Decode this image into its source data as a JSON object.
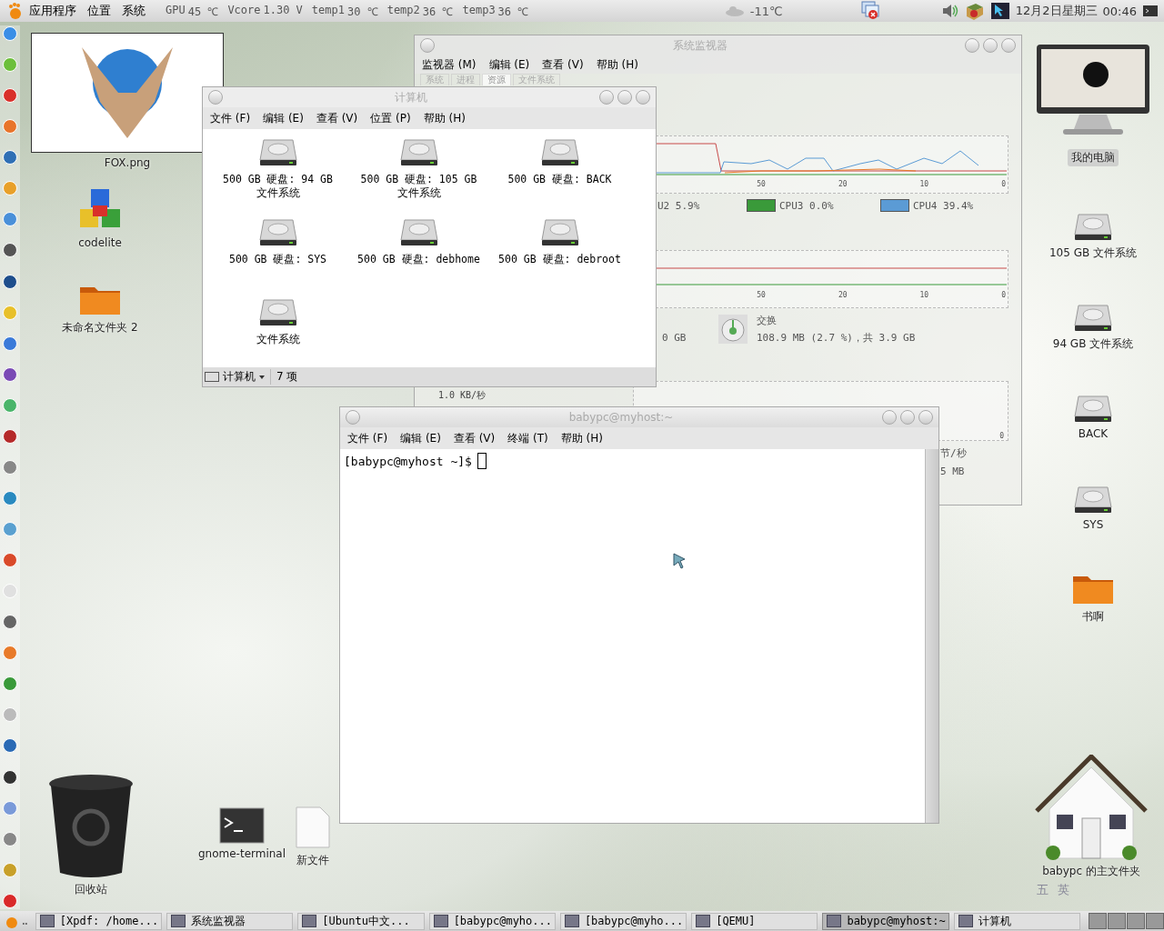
{
  "top_panel": {
    "menus": [
      "应用程序",
      "位置",
      "系统"
    ],
    "sensors": [
      {
        "label": "GPU",
        "value": "45 ℃"
      },
      {
        "label": "Vcore",
        "value": "1.30 V"
      },
      {
        "label": "temp1",
        "value": "30 ℃"
      },
      {
        "label": "temp2",
        "value": "36 ℃"
      },
      {
        "label": "temp3",
        "value": "36 ℃"
      }
    ],
    "weather": "-11℃",
    "date": "12月2日星期三",
    "time": "00:46"
  },
  "desktop_icons": [
    {
      "label": "FOX.png",
      "kind": "image"
    },
    {
      "label": "codelite",
      "kind": "app"
    },
    {
      "label": "未命名文件夹 2",
      "kind": "folder"
    },
    {
      "label": "回收站",
      "kind": "trash"
    },
    {
      "label": "gnome-terminal",
      "kind": "terminal"
    },
    {
      "label": "新文件",
      "kind": "file"
    },
    {
      "label": "我的电脑",
      "kind": "computer"
    },
    {
      "label": "105 GB 文件系统",
      "kind": "drive"
    },
    {
      "label": "94 GB 文件系统",
      "kind": "drive"
    },
    {
      "label": "BACK",
      "kind": "drive"
    },
    {
      "label": "SYS",
      "kind": "drive"
    },
    {
      "label": "书啊",
      "kind": "folder"
    },
    {
      "label": "babypc 的主文件夹",
      "kind": "house"
    }
  ],
  "system_monitor": {
    "title": "系统监视器",
    "menus": [
      "监视器 (M)",
      "编辑 (E)",
      "查看 (V)",
      "帮助 (H)"
    ],
    "tabs": [
      {
        "label": "系统",
        "selected": false
      },
      {
        "label": "进程",
        "selected": false
      },
      {
        "label": "资源",
        "selected": true
      },
      {
        "label": "文件系统",
        "selected": false
      }
    ],
    "cpu_graph": {
      "x_ticks": [
        "50",
        "20",
        "10",
        "0"
      ]
    },
    "cpu_legend": [
      {
        "label": "U2 5.9%"
      },
      {
        "label": "CPU3 0.0%",
        "color": "#3a9a3a"
      },
      {
        "label": "CPU4 39.4%",
        "color": "#5b9bd5"
      }
    ],
    "memory_graph": {
      "x_ticks": [
        "50",
        "20",
        "10",
        "0"
      ]
    },
    "memory_text": "0 GB",
    "swap": {
      "label": "交换",
      "value": "108.9 MB (2.7 %)，共 3.9 GB"
    },
    "network_graph": {
      "y_label": "1.0 KB/秒",
      "x_ticks": [
        "0"
      ]
    },
    "network_texts": [
      "节/秒",
      "5 MB"
    ]
  },
  "computer_window": {
    "title": "计算机",
    "menus": [
      "文件 (F)",
      "编辑 (E)",
      "查看 (V)",
      "位置 (P)",
      "帮助 (H)"
    ],
    "drives": [
      "500 GB 硬盘: 94 GB 文件系统",
      "500 GB 硬盘: 105 GB 文件系统",
      "500 GB 硬盘: BACK",
      "500 GB 硬盘: SYS",
      "500 GB 硬盘: debhome",
      "500 GB 硬盘: debroot",
      "文件系统"
    ],
    "location": "计算机",
    "count": "7 项"
  },
  "terminal": {
    "title": "babypc@myhost:~",
    "menus": [
      "文件 (F)",
      "编辑 (E)",
      "查看 (V)",
      "终端 (T)",
      "帮助 (H)"
    ],
    "prompt": "[babypc@myhost ~]$"
  },
  "taskbar": [
    {
      "label": "[Xpdf: /home...",
      "selected": false
    },
    {
      "label": "系统监视器",
      "selected": false
    },
    {
      "label": "[Ubuntu中文...",
      "selected": false
    },
    {
      "label": "[babypc@myho...",
      "selected": false
    },
    {
      "label": "[babypc@myho...",
      "selected": false
    },
    {
      "label": "[QEMU]",
      "selected": false
    },
    {
      "label": "babypc@myhost:~",
      "selected": true
    },
    {
      "label": "计算机",
      "selected": false
    }
  ],
  "input_method": [
    "五",
    "英"
  ]
}
